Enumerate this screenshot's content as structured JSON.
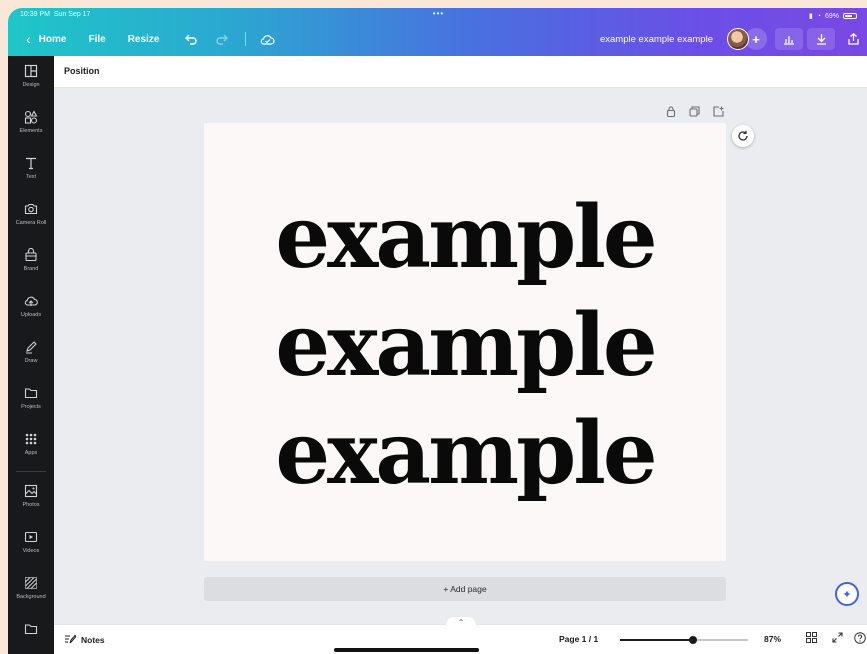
{
  "status_bar": {
    "time": "10:39 PM",
    "date": "Sun Sep 17",
    "battery": "69%",
    "dots": "•••"
  },
  "toolbar": {
    "home_label": "Home",
    "file_label": "File",
    "resize_label": "Resize",
    "doc_title": "example example example"
  },
  "sidebar": {
    "items": [
      {
        "label": "Design",
        "icon": "layout-icon"
      },
      {
        "label": "Elements",
        "icon": "shapes-icon"
      },
      {
        "label": "Text",
        "icon": "text-icon"
      },
      {
        "label": "Camera Roll",
        "icon": "camera-icon"
      },
      {
        "label": "Brand",
        "icon": "brand-icon"
      },
      {
        "label": "Uploads",
        "icon": "upload-cloud-icon"
      },
      {
        "label": "Draw",
        "icon": "pen-icon"
      },
      {
        "label": "Projects",
        "icon": "folder-icon"
      },
      {
        "label": "Apps",
        "icon": "grid-icon"
      },
      {
        "label": "Photos",
        "icon": "image-icon"
      },
      {
        "label": "Videos",
        "icon": "video-icon"
      },
      {
        "label": "Background",
        "icon": "hatch-icon"
      },
      {
        "label": "",
        "icon": "folder-icon"
      }
    ]
  },
  "header": {
    "title": "Position"
  },
  "canvas": {
    "lines": [
      "example",
      "example",
      "example"
    ],
    "add_page_label": "+ Add page"
  },
  "bottom_bar": {
    "notes_label": "Notes",
    "page_indicator": "Page 1 / 1",
    "zoom_label": "87%",
    "zoom_fraction": 0.57
  },
  "colors": {
    "accent": "#3f63e0",
    "sidebar_bg": "#18191b",
    "gradient_start": "#1fc6c8",
    "gradient_end": "#7a48e4"
  }
}
